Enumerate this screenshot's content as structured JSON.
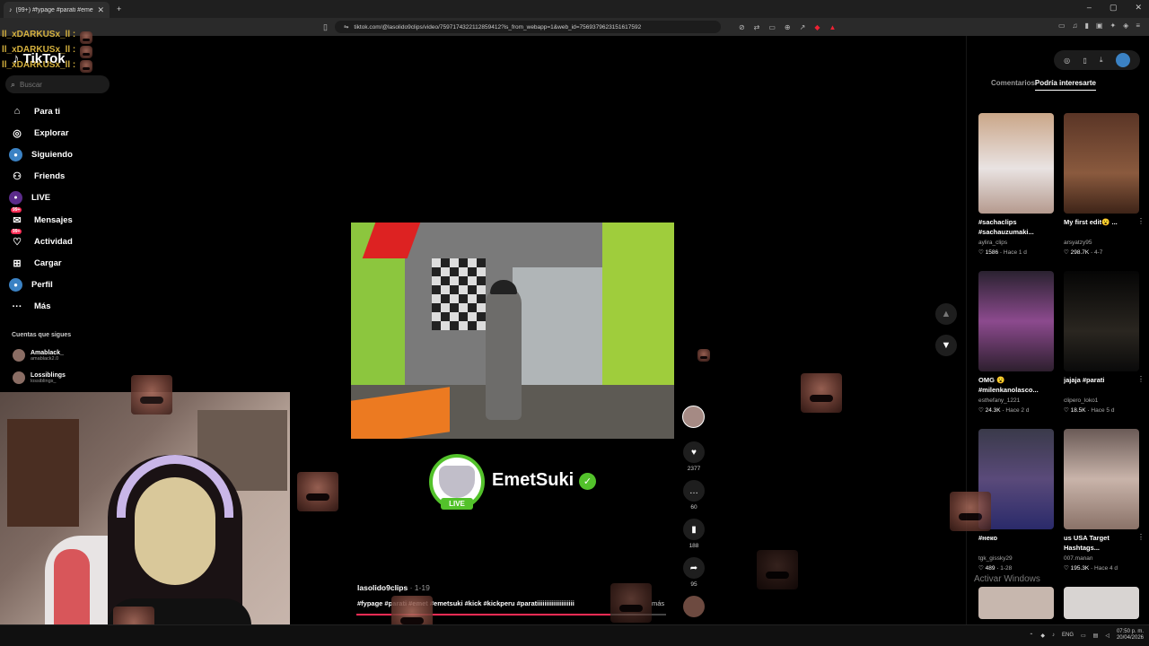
{
  "browser": {
    "tab_title": "(99+) #fypage #parati #emet",
    "url": "tiktok.com/@lasolido9clips/video/7597174322112859412?is_from_webapp=1&web_id=7569379623151617592"
  },
  "chat_overlay": [
    "ll_xDARKUSx_ll :",
    "ll_xDARKUSx_ll :",
    "ll_xDARKUSx_ll :"
  ],
  "sidebar": {
    "logo": "TikTok",
    "search_placeholder": "Buscar",
    "items": [
      {
        "label": "Para ti",
        "icon": "home-icon"
      },
      {
        "label": "Explorar",
        "icon": "compass-icon"
      },
      {
        "label": "Siguiendo",
        "icon": "following-icon"
      },
      {
        "label": "Friends",
        "icon": "friends-icon"
      },
      {
        "label": "LIVE",
        "icon": "live-icon"
      },
      {
        "label": "Mensajes",
        "icon": "messages-icon",
        "badge": "99+"
      },
      {
        "label": "Actividad",
        "icon": "activity-icon",
        "badge": "99+"
      },
      {
        "label": "Cargar",
        "icon": "upload-icon"
      },
      {
        "label": "Perfil",
        "icon": "profile-icon"
      },
      {
        "label": "Más",
        "icon": "more-icon"
      }
    ],
    "following_title": "Cuentas que sigues",
    "following": [
      {
        "name": "Amablack_",
        "handle": "amablack2.0"
      },
      {
        "name": "Lossiblings",
        "handle": "lossiblings_"
      }
    ]
  },
  "video": {
    "streamer_name": "EmetSuki",
    "live_label": "LIVE",
    "author": "lasolido9clips",
    "date": "· 1-19",
    "caption": "#fypage #parati #emet #emetsuki #kick #kickperu #paratiiiiiiiiiiiiiiiiiiii",
    "more_label": "más",
    "progress": 0.82,
    "likes": "2377",
    "comments": "60",
    "saves": "188",
    "shares": "95"
  },
  "right_panel": {
    "tabs": [
      "Comentarios",
      "Podría interesarte"
    ],
    "active_tab": 1,
    "watermark": "Activar Windows",
    "cards": [
      {
        "title": "#sachaclips #sachauzumaki...",
        "user": "aylira_clips",
        "likes": "1586",
        "date": "Hace 1 d"
      },
      {
        "title": "My first edit😮 ...",
        "user": "arsyatzy95",
        "likes": "298.7K",
        "date": "4-7"
      },
      {
        "title": "OMG 😮 #milenkanolasco...",
        "user": "esthefany_1221",
        "likes": "24.3K",
        "date": "Hace 2 d"
      },
      {
        "title": "jajaja #parati",
        "user": "clipero_loko1",
        "likes": "18.5K",
        "date": "Hace 5 d"
      },
      {
        "title": "#неко",
        "user": "tgk_gissky29",
        "likes": "489",
        "date": "1-28"
      },
      {
        "title": "us USA Target Hashtags...",
        "user": "007.manan",
        "likes": "195.3K",
        "date": "Hace 4 d"
      }
    ]
  },
  "taskbar": {
    "lang": "ENG",
    "time": "07:50 p. m.",
    "date": "20/04/2026"
  },
  "colors": {
    "accent": "#fe2c55",
    "live_green": "#53c22b",
    "chat_gold": "#d4b03e"
  }
}
